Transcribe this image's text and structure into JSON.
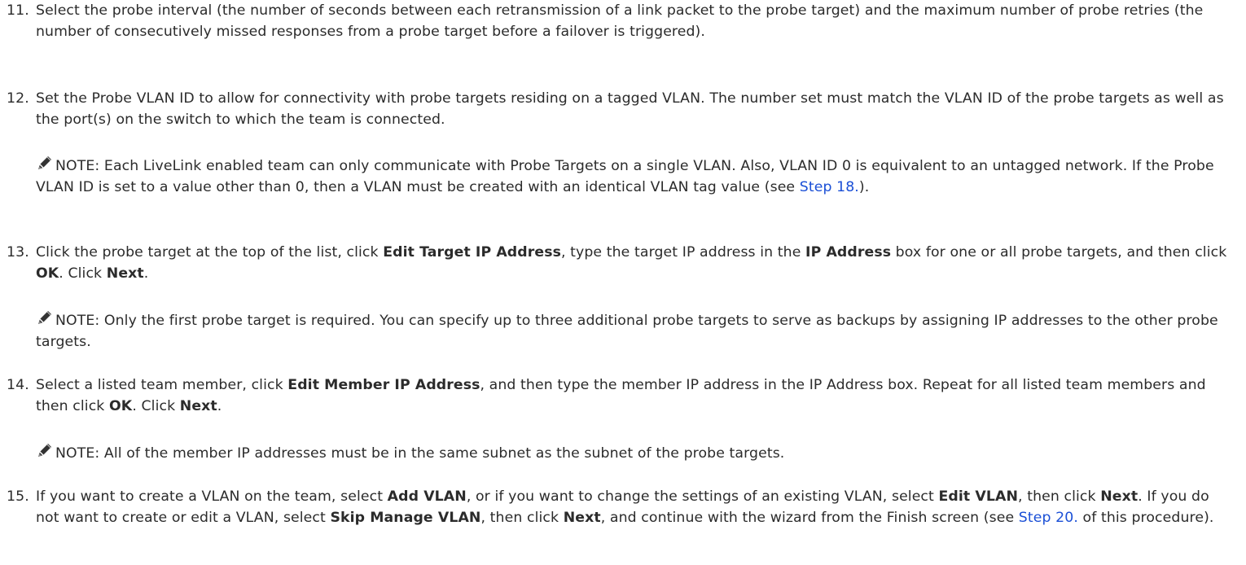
{
  "steps": [
    {
      "num": "11.",
      "text": "Select the probe interval (the number of seconds between each retransmission of a link packet to the probe target) and the maximum number of probe retries (the number of consecutively missed responses from a probe target before a failover is triggered)."
    },
    {
      "num": "12.",
      "text": "Set the Probe VLAN ID to allow for connectivity with probe targets residing on a tagged VLAN. The number set must match the VLAN ID of the probe targets as well as the port(s) on the switch to which the team is connected."
    },
    {
      "num": "13.",
      "t1": "Click the probe target at the top of the list, click ",
      "b1": "Edit Target IP Address",
      "t2": ", type the target IP address in the ",
      "b2": "IP Address",
      "t3": " box for one or all probe targets, and then click ",
      "b3": "OK",
      "t4": ". Click ",
      "b4": "Next",
      "t5": "."
    },
    {
      "num": "14.",
      "t1": "Select a listed team member, click ",
      "b1": "Edit Member IP Address",
      "t2": ", and then type the member IP address in the IP Address box. Repeat for all listed team members and then click ",
      "b2": "OK",
      "t3": ". Click ",
      "b3": "Next",
      "t4": "."
    },
    {
      "num": "15.",
      "t1": "If you want to create a VLAN on the team, select ",
      "b1": "Add VLAN",
      "t2": ", or if you want to change the settings of an existing VLAN, select ",
      "b2": "Edit VLAN",
      "t3": ", then click ",
      "b3": "Next",
      "t4": ". If you do not want to create or edit a VLAN, select ",
      "b4": "Skip Manage VLAN",
      "t5": ", then click ",
      "b5": "Next",
      "t6": ", and continue with the wizard from the Finish screen (see ",
      "link": "Step 20.",
      "t7": " of this procedure)."
    }
  ],
  "notes": [
    {
      "t1": "NOTE: Each LiveLink enabled team can only communicate with Probe Targets on a single VLAN. Also, VLAN ID 0 is equivalent to an untagged network. If the Probe VLAN ID is set to a value other than 0, then a VLAN must be created with an identical VLAN tag value (see ",
      "link": "Step 18.",
      "t2": ")."
    },
    {
      "text": "NOTE: Only the first probe target is required. You can specify up to three additional probe targets to serve as backups by assigning IP addresses to the other probe targets."
    },
    {
      "text": "NOTE: All of the member IP addresses must be in the same subnet as the subnet of the probe targets."
    }
  ],
  "icons": {
    "note": "pencil-note-icon"
  },
  "colors": {
    "text": "#2b2b2b",
    "link": "#1a4fd6"
  }
}
